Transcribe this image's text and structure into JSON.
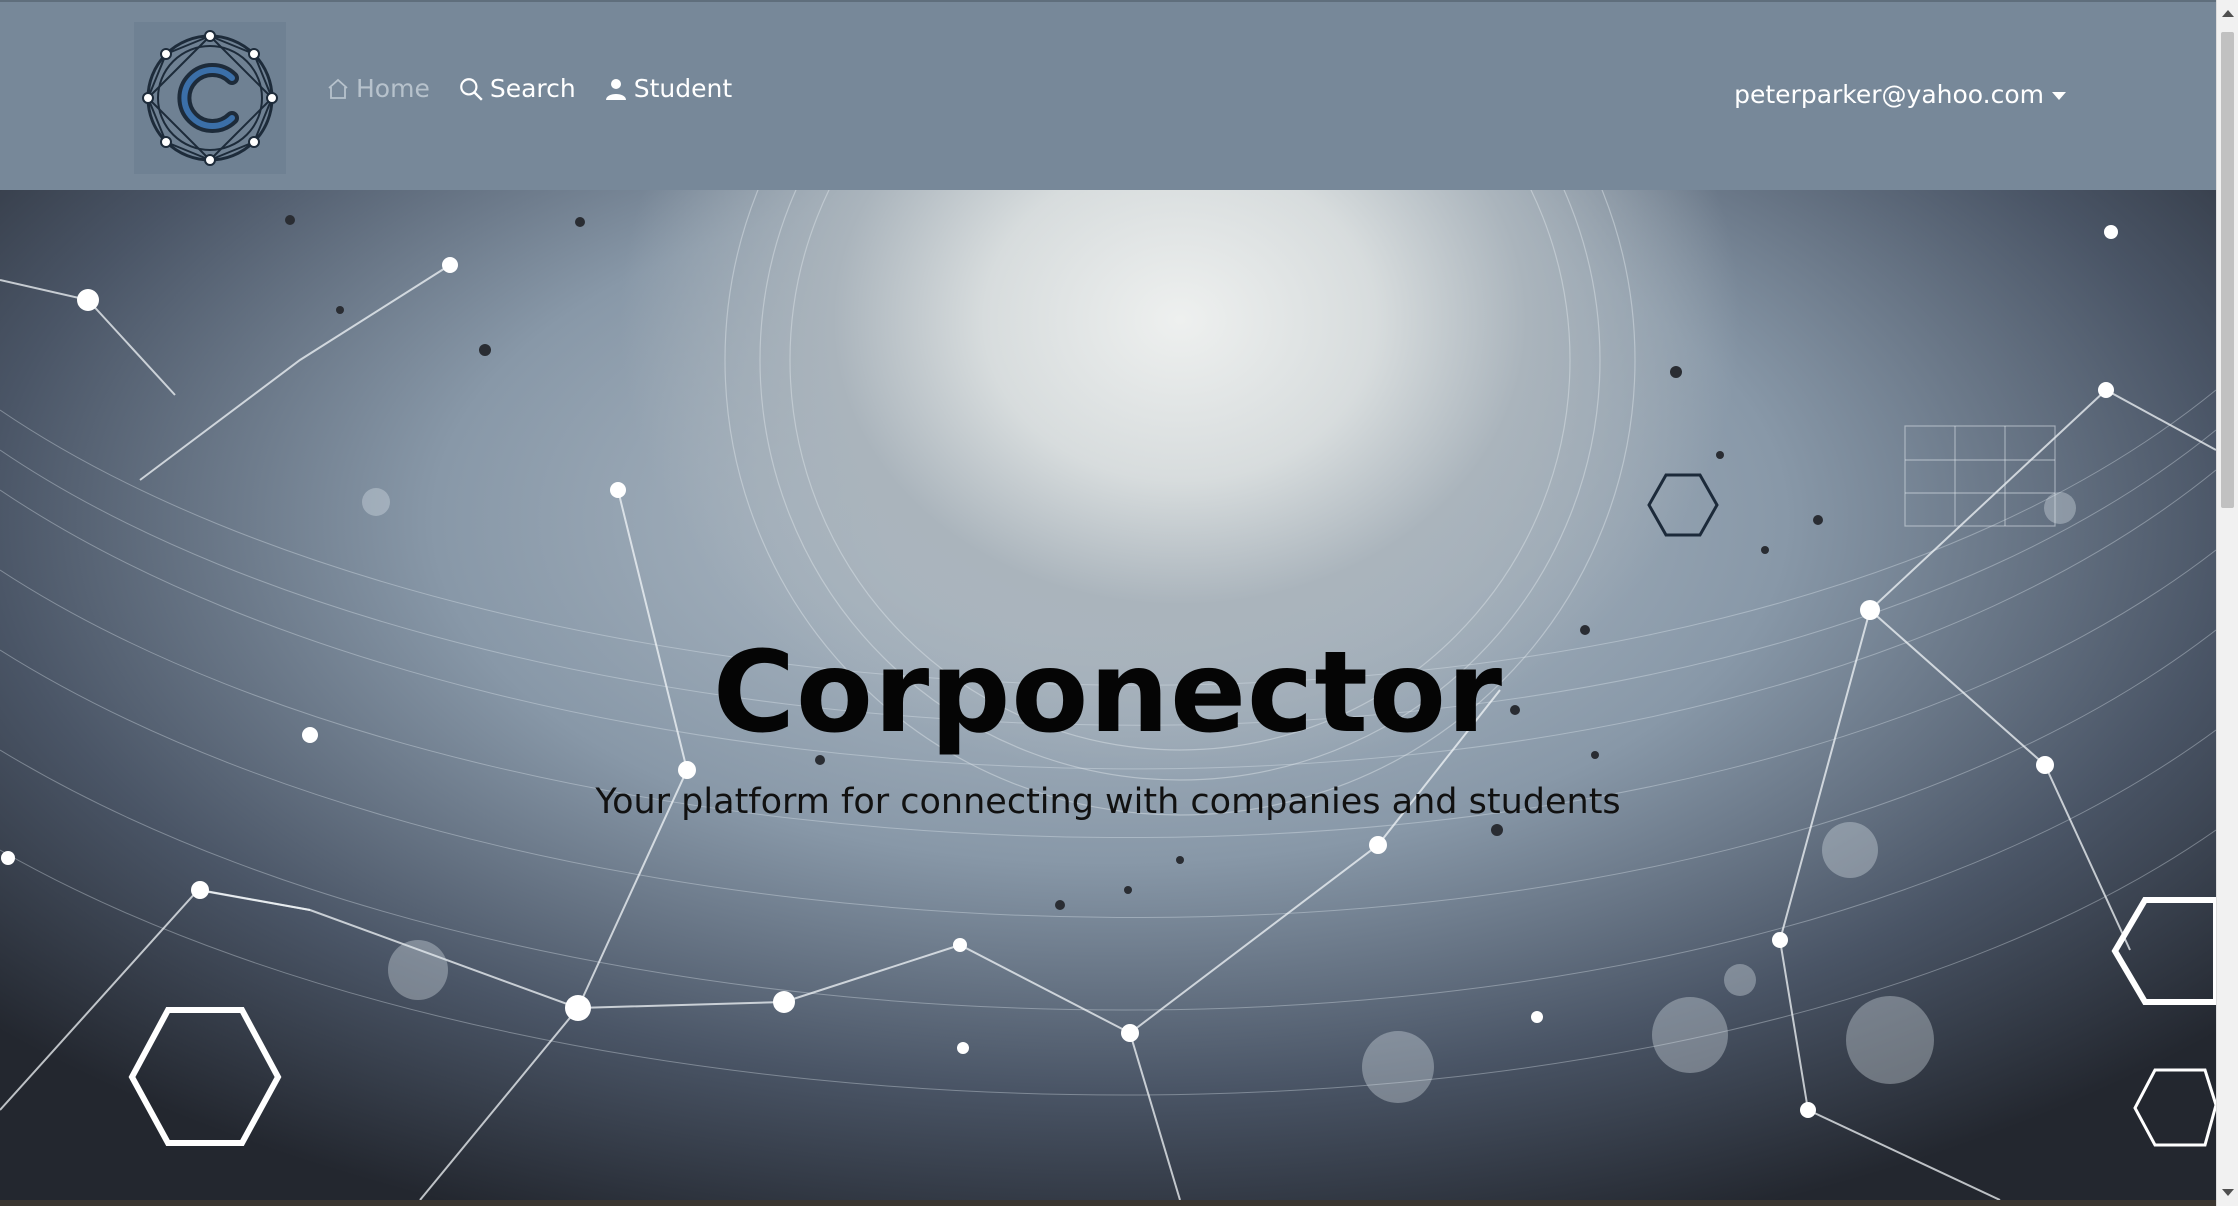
{
  "navbar": {
    "brand_icon": "corponector-logo",
    "links": [
      {
        "label": "Home",
        "icon": "home-icon",
        "active": false
      },
      {
        "label": "Search",
        "icon": "search-icon"
      },
      {
        "label": "Student",
        "icon": "person-icon"
      }
    ],
    "user_email": "peterparker@yahoo.com"
  },
  "hero": {
    "title": "Corponector",
    "subtitle": "Your platform for connecting with companies and students"
  },
  "colors": {
    "navbar_bg": "#778899",
    "nav_text": "#ffffff",
    "nav_disabled_text": "#b7c2cc",
    "hero_text": "#050505"
  }
}
